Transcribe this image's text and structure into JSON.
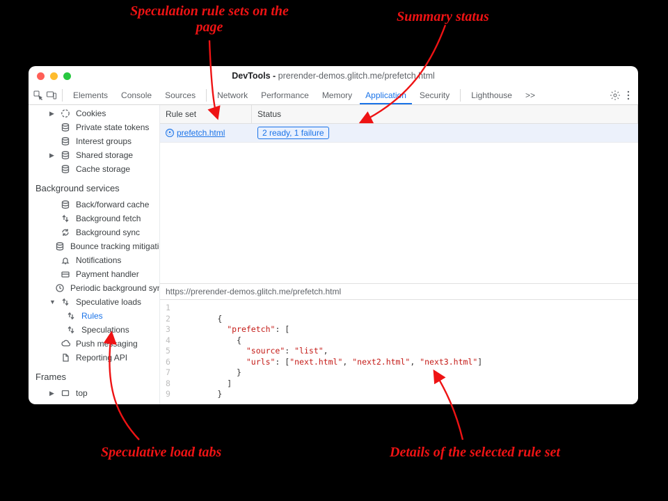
{
  "annotations": {
    "top_left": "Speculation rule sets\non the page",
    "top_right": "Summary status",
    "bottom_left": "Speculative load tabs",
    "bottom_right": "Details of the selected rule set"
  },
  "window": {
    "title_prefix": "DevTools - ",
    "title_host": "prerender-demos.glitch.me",
    "title_path": "/prefetch.html"
  },
  "toolbar": {
    "tabs": [
      "Elements",
      "Console",
      "Sources",
      "Network",
      "Performance",
      "Memory",
      "Application",
      "Security",
      "Lighthouse"
    ],
    "active_tab": "Application",
    "chevron": ">>"
  },
  "sidebar": {
    "app_items": [
      {
        "label": "Cookies",
        "icon": "cookie",
        "arrow": "right"
      },
      {
        "label": "Private state tokens",
        "icon": "db"
      },
      {
        "label": "Interest groups",
        "icon": "db"
      },
      {
        "label": "Shared storage",
        "icon": "db",
        "arrow": "right"
      },
      {
        "label": "Cache storage",
        "icon": "db"
      }
    ],
    "bg_title": "Background services",
    "bg_items": [
      {
        "label": "Back/forward cache",
        "icon": "db"
      },
      {
        "label": "Background fetch",
        "icon": "updown"
      },
      {
        "label": "Background sync",
        "icon": "sync"
      },
      {
        "label": "Bounce tracking mitigations",
        "icon": "db"
      },
      {
        "label": "Notifications",
        "icon": "bell"
      },
      {
        "label": "Payment handler",
        "icon": "card"
      },
      {
        "label": "Periodic background sync",
        "icon": "clock"
      },
      {
        "label": "Speculative loads",
        "icon": "updown",
        "arrow": "down",
        "expanded": true,
        "children": [
          {
            "label": "Rules",
            "icon": "updown",
            "selected": true
          },
          {
            "label": "Speculations",
            "icon": "updown"
          }
        ]
      },
      {
        "label": "Push messaging",
        "icon": "cloud"
      },
      {
        "label": "Reporting API",
        "icon": "file"
      }
    ],
    "frames_title": "Frames",
    "frames_items": [
      {
        "label": "top",
        "icon": "frame",
        "arrow": "right"
      }
    ]
  },
  "ruleset_table": {
    "headers": {
      "rule": "Rule set",
      "status": "Status"
    },
    "rows": [
      {
        "rule": "prefetch.html",
        "status": "2 ready, 1 failure"
      }
    ]
  },
  "detail": {
    "url": "https://prerender-demos.glitch.me/prefetch.html",
    "code_line_count": 9,
    "json": {
      "key_prefetch": "\"prefetch\"",
      "key_source": "\"source\"",
      "val_source": "\"list\"",
      "key_urls": "\"urls\"",
      "urls": [
        "\"next.html\"",
        "\"next2.html\"",
        "\"next3.html\""
      ]
    }
  },
  "colors": {
    "annotation": "#ee1314",
    "accent": "#1a73e8"
  }
}
